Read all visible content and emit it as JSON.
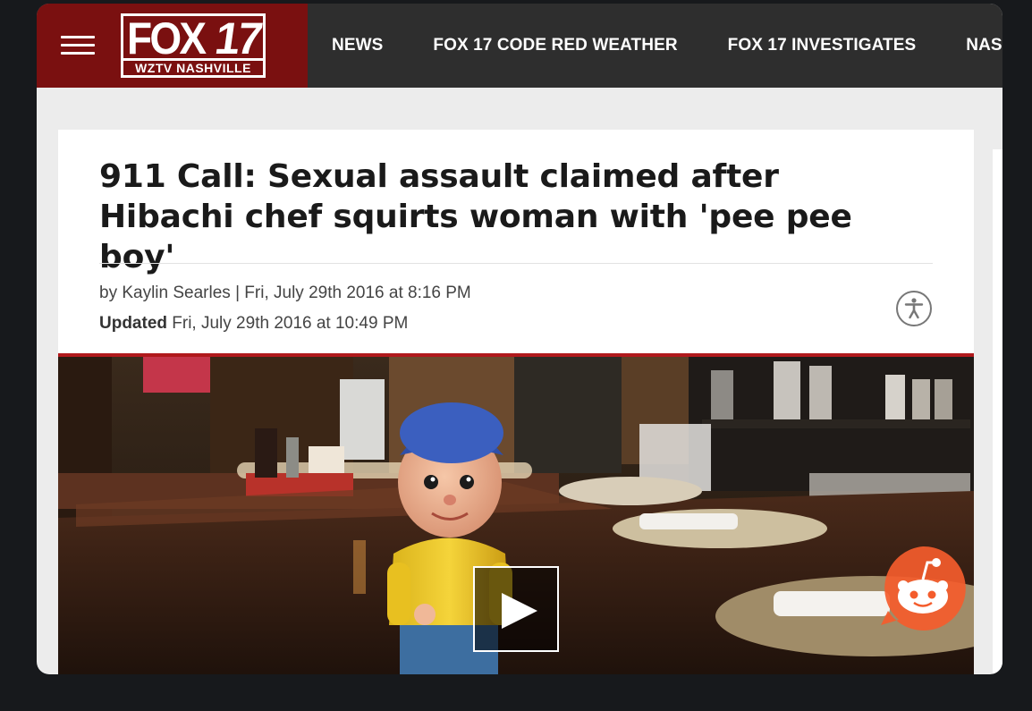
{
  "site": {
    "logo_text": "FOX",
    "logo_number": "17",
    "logo_subtitle": "WZTV NASHVILLE",
    "brand_color": "#7a1010",
    "menu_icon": "hamburger-menu-icon"
  },
  "nav": {
    "items": [
      {
        "label": "NEWS"
      },
      {
        "label": "FOX 17 CODE RED WEATHER"
      },
      {
        "label": "FOX 17 INVESTIGATES"
      },
      {
        "label": "NASHVII"
      }
    ]
  },
  "article": {
    "headline": "911 Call: Sexual assault claimed after Hibachi chef squirts woman with 'pee pee boy'",
    "byline": "by Kaylin Searles | Fri, July 29th 2016 at 8:16 PM",
    "updated_label": "Updated",
    "updated_time": "Fri, July 29th 2016 at 10:49 PM",
    "accessibility_icon": "accessibility-icon",
    "accent_color": "#b0191c"
  },
  "media": {
    "play_icon": "play-icon",
    "share_icon": "reddit-icon"
  }
}
